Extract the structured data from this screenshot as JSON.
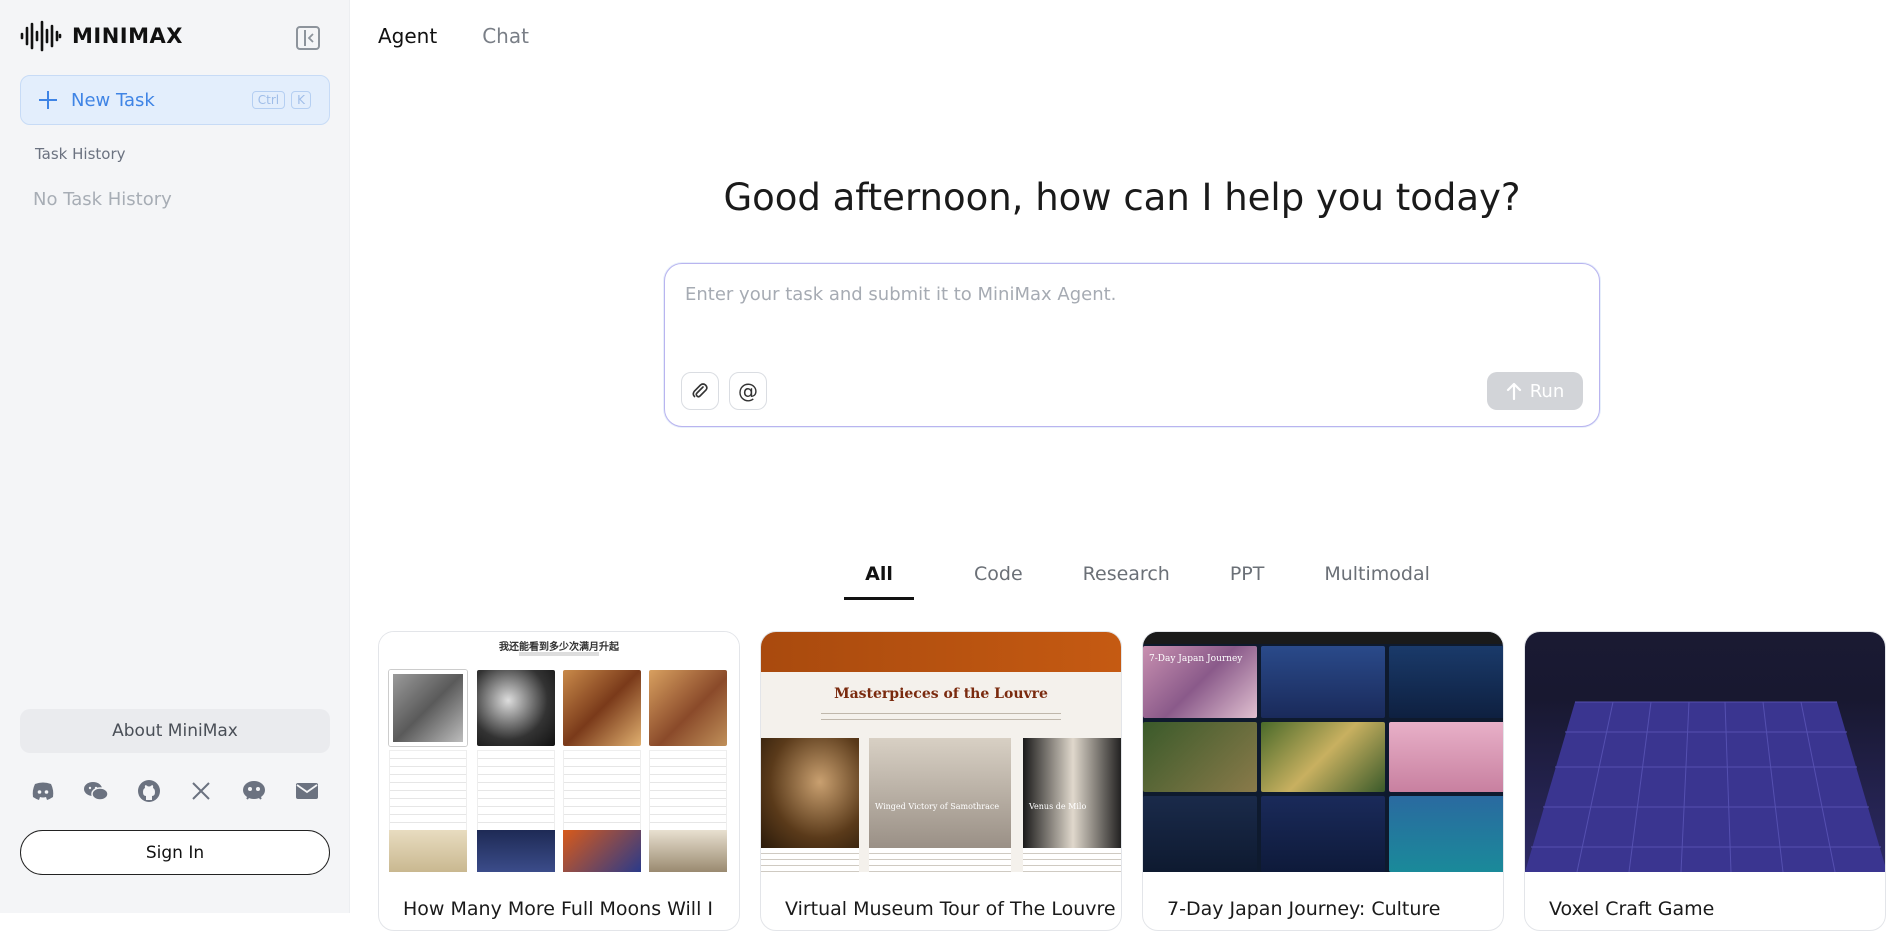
{
  "brand": {
    "name": "MINIMAX"
  },
  "sidebar": {
    "new_task": {
      "label": "New Task",
      "shortcut": [
        "Ctrl",
        "K"
      ]
    },
    "task_history_title": "Task History",
    "no_history": "No Task History",
    "about": "About MiniMax",
    "social_icons": [
      "discord-icon",
      "wechat-icon",
      "github-icon",
      "x-icon",
      "community-icon",
      "mail-icon"
    ],
    "sign_in": "Sign In"
  },
  "mode_tabs": [
    {
      "label": "Agent",
      "active": true
    },
    {
      "label": "Chat",
      "active": false
    }
  ],
  "greeting": "Good afternoon, how can I help you today?",
  "prompt": {
    "placeholder": "Enter your task and submit it to MiniMax Agent.",
    "run_label": "Run"
  },
  "category_tabs": [
    {
      "label": "All",
      "active": true
    },
    {
      "label": "Code",
      "active": false
    },
    {
      "label": "Research",
      "active": false
    },
    {
      "label": "PPT",
      "active": false
    },
    {
      "label": "Multimodal",
      "active": false
    }
  ],
  "cards": [
    {
      "title": "How Many More Full Moons Will I",
      "thumb_heading": "我还能看到多少次满月升起"
    },
    {
      "title": "Virtual Museum Tour of The Louvre",
      "thumb_heading": "Masterpieces of the Louvre",
      "thumb_captions": [
        "Winged Victory of Samothrace",
        "Venus de Milo"
      ]
    },
    {
      "title": "7-Day Japan Journey: Culture",
      "thumb_heading": "7-Day Japan Journey"
    },
    {
      "title": "Voxel Craft Game"
    }
  ],
  "colors": {
    "accent": "#3f84e5",
    "sidebar_bg": "#f4f5f7",
    "prompt_border": "#b9b4ef",
    "run_disabled": "#d2d4d8"
  }
}
